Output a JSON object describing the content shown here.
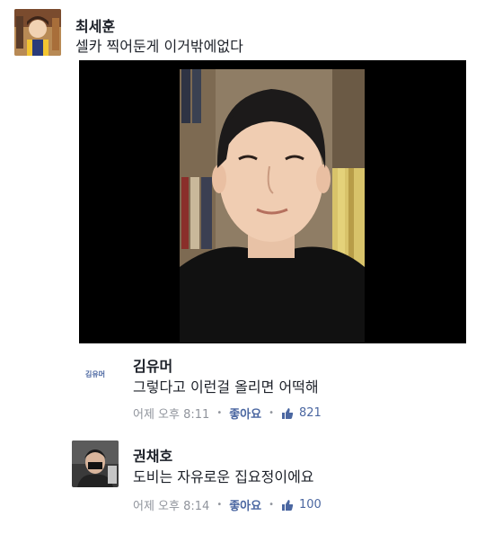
{
  "post": {
    "author": "최세훈",
    "text": "셀카 찍어둔게 이거밖에없다"
  },
  "comments": [
    {
      "author": "김유머",
      "avatar_text": "김유머",
      "text": "그렇다고 이런걸 올리면 어떡해",
      "time": "어제 오후 8:11",
      "like_label": "좋아요",
      "like_count": "821"
    },
    {
      "author": "권채호",
      "text": "도비는 자유로운 집요정이에요",
      "time": "어제 오후 8:14",
      "like_label": "좋아요",
      "like_count": "100"
    }
  ],
  "colors": {
    "link_blue": "#4b67a1",
    "meta_gray": "#90949c"
  },
  "icons": [
    "thumbs-up-icon"
  ]
}
